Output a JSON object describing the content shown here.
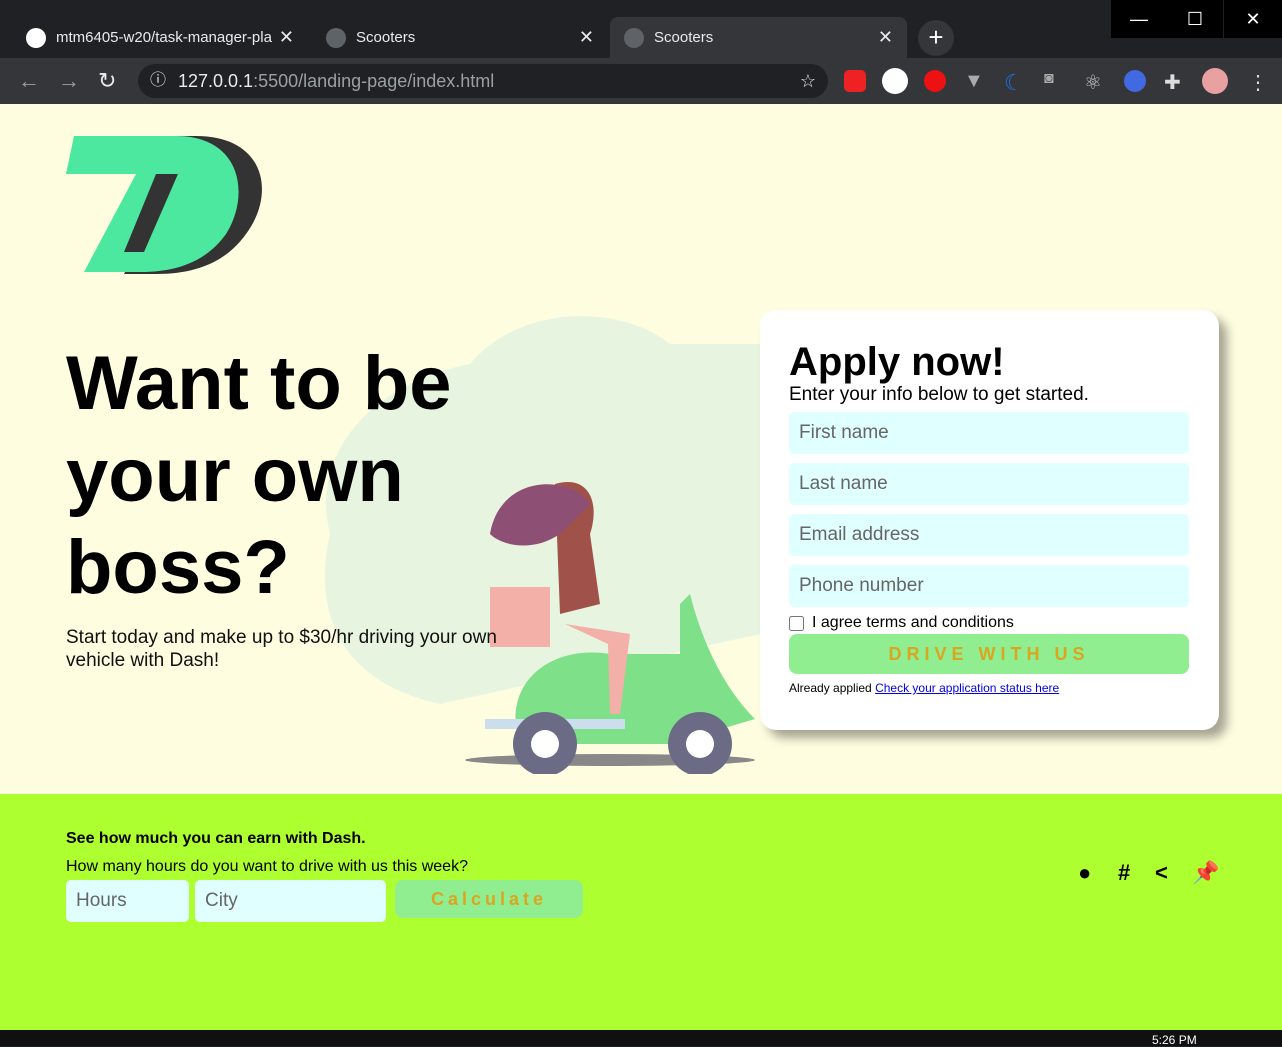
{
  "browser": {
    "tabs": [
      {
        "title": "mtm6405-w20/task-manager-pla",
        "icon": "github-icon"
      },
      {
        "title": "Scooters",
        "icon": "globe-icon"
      },
      {
        "title": "Scooters",
        "icon": "globe-icon",
        "active": true
      }
    ],
    "url_host": "127.0.0.1",
    "url_rest": ":5500/landing-page/index.html"
  },
  "hero": {
    "line1": "Want to be",
    "line2": "your own",
    "line3": "boss?",
    "subtitle": "Start today and make up to $30/hr driving your own vehicle with Dash!"
  },
  "form": {
    "title": "Apply now!",
    "subtitle": "Enter your info below to get started.",
    "first_name": "First name",
    "last_name": "Last name",
    "email": "Email address",
    "phone": "Phone number",
    "agree": "I agree terms and conditions",
    "submit": "DRIVE WITH US",
    "already": "Already applied",
    "status_link": "Check your application status here"
  },
  "earn": {
    "title": "See how much you can earn with Dash.",
    "question": "How many hours do you want to drive with us this week?",
    "hours_placeholder": "Hours",
    "city_placeholder": "City",
    "calculate": "Calculate"
  },
  "social_icons": [
    "comment-icon",
    "hashtag-icon",
    "share-icon",
    "pin-icon"
  ],
  "taskbar": {
    "time": "5:26 PM"
  },
  "colors": {
    "page_bg": "#fffde0",
    "footer_bg": "#adff2f",
    "button_bg": "#90ee90",
    "button_text": "#daa520",
    "input_bg": "#e0ffff",
    "logo_green": "#4de8a0"
  }
}
